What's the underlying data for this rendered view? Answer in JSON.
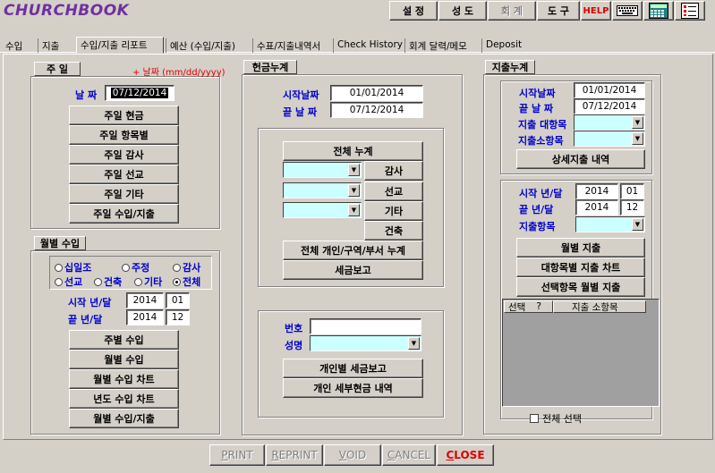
{
  "app": {
    "title": "CHURCHBOOK"
  },
  "toolbar": {
    "buttons": [
      {
        "label": "설 정"
      },
      {
        "label": "성 도"
      },
      {
        "label": "회 계"
      },
      {
        "label": "도 구"
      },
      {
        "label": "HELP"
      }
    ]
  },
  "tabs": [
    {
      "label": "수입"
    },
    {
      "label": "지출"
    },
    {
      "label": "수입/지출 리포트"
    },
    {
      "label": "예산 (수입/지출)"
    },
    {
      "label": "수표/지출내역서"
    },
    {
      "label": "Check History"
    },
    {
      "label": "회계 달력/메모"
    },
    {
      "label": "Deposit"
    }
  ],
  "sunday": {
    "title": "주     일",
    "date_hint": "+ 날짜 (mm/dd/yyyy)",
    "date_label": "날   짜",
    "date_value": "07/12/2014",
    "buttons": [
      "주일 현금",
      "주일 항목별",
      "주일 감사",
      "주일 선교",
      "주일 기타",
      "주일 수입/지출"
    ]
  },
  "monthly": {
    "title": "월별 수입",
    "radios": [
      {
        "label": "십일조",
        "checked": false
      },
      {
        "label": "주정",
        "checked": false
      },
      {
        "label": "감사",
        "checked": false
      },
      {
        "label": "선교",
        "checked": false
      },
      {
        "label": "건축",
        "checked": false
      },
      {
        "label": "기타",
        "checked": false
      },
      {
        "label": "전체",
        "checked": true
      }
    ],
    "start_label": "시작 년/달",
    "start_year": "2014",
    "start_month": "01",
    "end_label": "끝    년/달",
    "end_year": "2014",
    "end_month": "12",
    "buttons": [
      "주별 수입",
      "월별 수입",
      "월별 수입 차트",
      "년도 수입 차트",
      "월별 수입/지출"
    ]
  },
  "cash": {
    "title": "헌금누계",
    "start_label": "시작날짜",
    "start_value": "01/01/2014",
    "end_label": "끝 날 짜",
    "end_value": "07/12/2014",
    "total_button": "전체 누계",
    "side_buttons": [
      "감사",
      "선교",
      "기타",
      "건축"
    ],
    "wide_buttons": [
      "전체 개인/구역/부서 누계",
      "세금보고"
    ],
    "no_label": "번호",
    "name_label": "성명",
    "person_buttons": [
      "개인별 세금보고",
      "개인 세부현금 내역"
    ]
  },
  "expense": {
    "title": "지출누계",
    "start_label": "시작날짜",
    "start_value": "01/01/2014",
    "end_label": "끝  날  짜",
    "end_value": "07/12/2014",
    "major_label": "지출 대항목",
    "minor_label": "지출소항목",
    "detail_button": "상세지출 내역",
    "start_ym_label": "시작 년/달",
    "start_year": "2014",
    "start_month": "01",
    "end_ym_label": "끝    년/달",
    "end_year": "2014",
    "end_month": "12",
    "item_label": "지출항목",
    "buttons": [
      "월별 지출",
      "대항목별 지출 차트",
      "선택항목 월별 지출"
    ],
    "list_headers": [
      "선택",
      "?",
      "지출 소항목"
    ],
    "select_all": "전체 선택"
  },
  "bottom": {
    "buttons": [
      {
        "label": "PRINT",
        "u": "P",
        "rest": "RINT"
      },
      {
        "label": "REPRINT",
        "u": "R",
        "rest": "EPRINT"
      },
      {
        "label": "VOID",
        "u": "V",
        "rest": "OID"
      },
      {
        "label": "CANCEL",
        "u": "C",
        "rest": "ANCEL"
      },
      {
        "label": "CLOSE",
        "u": "C",
        "rest": "LOSE"
      }
    ]
  },
  "colors": {
    "background": "#d4d0c8",
    "accent_blue": "#0000cc",
    "accent_red": "#e00000",
    "combo_fill": "#ccffff",
    "logo": "#7030a0"
  }
}
